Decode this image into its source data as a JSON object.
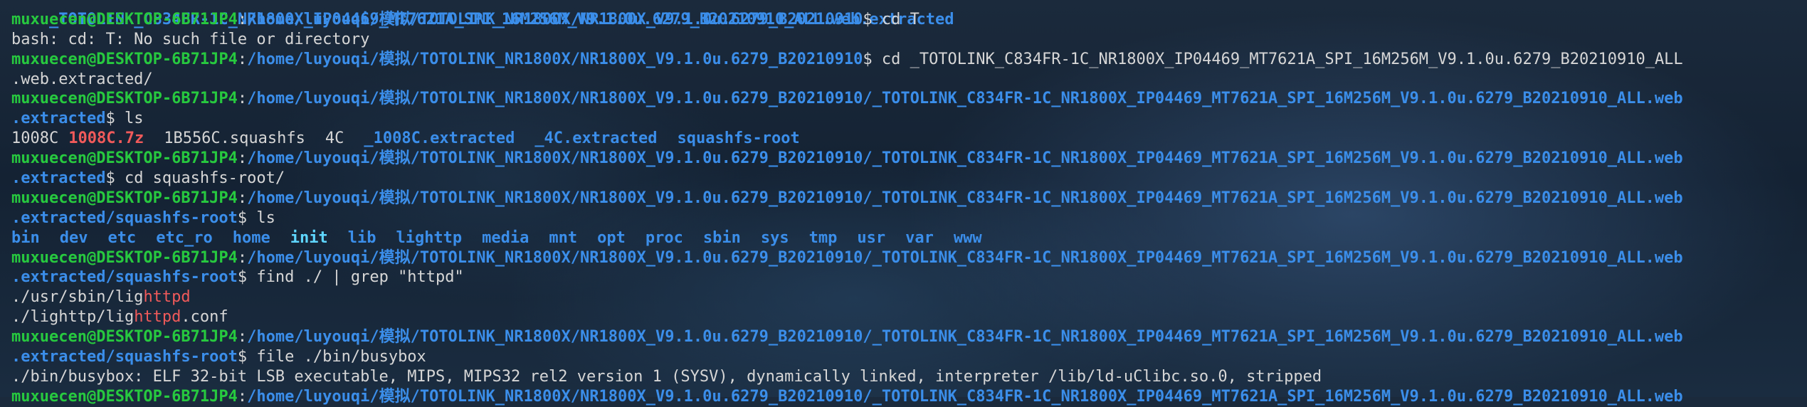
{
  "prompt": {
    "user_host": "muxuecen@DESKTOP-6B71JP4",
    "sep": ":",
    "dollar": "$"
  },
  "lines": {
    "l0_path": "_TOTOLINK_C834FR-1C_NR1800X_IP04469_MT7621A_SPI_16M256M_V9.1.0u.6279_B20210910_ALL.web.extracted",
    "l1_path": "/home/luyouqi/模拟/TOTOLINK_NR1800X/NR1800X_V9.1.0u.6279_B20210910",
    "l1_cmd": " cd T",
    "l2_text": "bash: cd: T: No such file or directory",
    "l3_path": "/home/luyouqi/模拟/TOTOLINK_NR1800X/NR1800X_V9.1.0u.6279_B20210910",
    "l3_cmd": " cd _TOTOLINK_C834FR-1C_NR1800X_IP04469_MT7621A_SPI_16M256M_V9.1.0u.6279_B20210910_ALL",
    "l4_text": ".web.extracted/",
    "l5_path": "/home/luyouqi/模拟/TOTOLINK_NR1800X/NR1800X_V9.1.0u.6279_B20210910/_TOTOLINK_C834FR-1C_NR1800X_IP04469_MT7621A_SPI_16M256M_V9.1.0u.6279_B20210910_ALL.web",
    "l6_path": ".extracted",
    "l6_cmd": " ls",
    "l8_path": "/home/luyouqi/模拟/TOTOLINK_NR1800X/NR1800X_V9.1.0u.6279_B20210910/_TOTOLINK_C834FR-1C_NR1800X_IP04469_MT7621A_SPI_16M256M_V9.1.0u.6279_B20210910_ALL.web",
    "l9_path": ".extracted",
    "l9_cmd": " cd squashfs-root/",
    "l10_path": "/home/luyouqi/模拟/TOTOLINK_NR1800X/NR1800X_V9.1.0u.6279_B20210910/_TOTOLINK_C834FR-1C_NR1800X_IP04469_MT7621A_SPI_16M256M_V9.1.0u.6279_B20210910_ALL.web",
    "l11_path": ".extracted/squashfs-root",
    "l11_cmd": " ls",
    "l13_path": "/home/luyouqi/模拟/TOTOLINK_NR1800X/NR1800X_V9.1.0u.6279_B20210910/_TOTOLINK_C834FR-1C_NR1800X_IP04469_MT7621A_SPI_16M256M_V9.1.0u.6279_B20210910_ALL.web",
    "l14_path": ".extracted/squashfs-root",
    "l14_cmd": " find ./ | grep \"httpd\"",
    "l15_pre": "./usr/sbin/lig",
    "l15_hl": "httpd",
    "l16_pre": "./lighttp/lig",
    "l16_hl": "httpd",
    "l16_post": ".conf",
    "l17_path": "/home/luyouqi/模拟/TOTOLINK_NR1800X/NR1800X_V9.1.0u.6279_B20210910/_TOTOLINK_C834FR-1C_NR1800X_IP04469_MT7621A_SPI_16M256M_V9.1.0u.6279_B20210910_ALL.web",
    "l18_path": ".extracted/squashfs-root",
    "l18_cmd": " file ./bin/busybox",
    "l19_text": "./bin/busybox: ELF 32-bit LSB executable, MIPS, MIPS32 rel2 version 1 (SYSV), dynamically linked, interpreter /lib/ld-uClibc.so.0, stripped",
    "l20_path": "/home/luyouqi/模拟/TOTOLINK_NR1800X/NR1800X_V9.1.0u.6279_B20210910/_TOTOLINK_C834FR-1C_NR1800X_IP04469_MT7621A_SPI_16M256M_V9.1.0u.6279_B20210910_ALL.web"
  },
  "ls_extracted": {
    "f1": "1008C",
    "f2": "1008C.7z",
    "f3": "1B556C.squashfs",
    "f4": "4C",
    "f5": "_1008C.extracted",
    "f6": "_4C.extracted",
    "f7": "squashfs-root"
  },
  "ls_root": [
    "bin",
    "dev",
    "etc",
    "etc_ro",
    "home",
    "init",
    "lib",
    "lighttp",
    "media",
    "mnt",
    "opt",
    "proc",
    "sbin",
    "sys",
    "tmp",
    "usr",
    "var",
    "www"
  ]
}
